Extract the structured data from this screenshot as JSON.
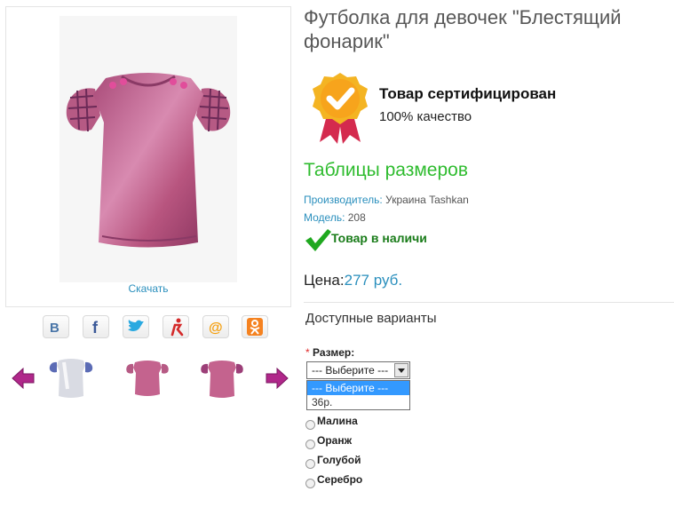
{
  "product": {
    "title": "Футболка для девочек \"Блестящий фонарик\"",
    "image_alt": "girls-tshirt-pink",
    "download_label": "Скачать"
  },
  "certificate": {
    "title": "Товар сертифицирован",
    "subtitle": "100% качество"
  },
  "size_tables_link": "Таблицы размеров",
  "specs": {
    "manufacturer_label": "Производитель:",
    "manufacturer_value": "Украина Tashkan",
    "model_label": "Модель:",
    "model_value": "208"
  },
  "stock": "Товар в наличи",
  "price": {
    "label": "Цена:",
    "value": "277 руб."
  },
  "variants": {
    "heading": "Доступные варианты",
    "size_label": "Размер:",
    "required_mark": "*",
    "select_value": "--- Выберите ---",
    "options": [
      "--- Выберите ---",
      "36р."
    ],
    "colors": [
      "Малина",
      "Оранж",
      "Голубой",
      "Серебро"
    ]
  },
  "social": [
    "vk-icon",
    "facebook-icon",
    "twitter-icon",
    "moimir-icon",
    "mail-icon",
    "odnoklassniki-icon"
  ],
  "colors": {
    "accent_blue": "#2a8fbd",
    "accent_green": "#2fbc2f",
    "stock_green": "#1a7c1a",
    "shirt_pink": "#c4638e",
    "arrow_magenta": "#b0278a"
  }
}
